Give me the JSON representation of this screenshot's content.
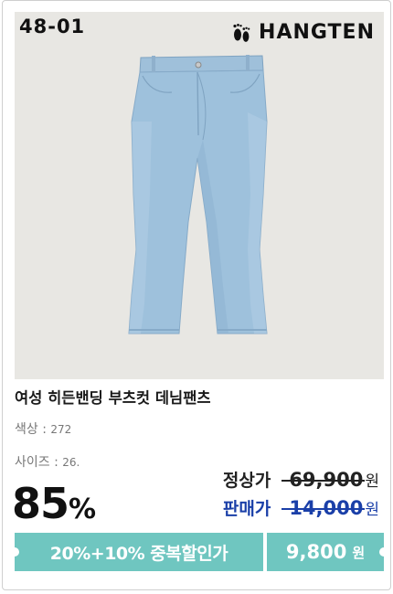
{
  "product": {
    "code": "48-01",
    "brand": "HANGTEN",
    "title": "여성 히든밴딩 부츠컷 데님팬츠",
    "color_label": "색상 : ",
    "color_value": "272",
    "size_label": "사이즈 : ",
    "size_value": "26."
  },
  "pricing": {
    "discount_number": "85",
    "discount_symbol": "%",
    "regular_label": "정상가",
    "regular_price": "69,900",
    "sale_label": "판매가",
    "sale_price": "14,000",
    "won": "원"
  },
  "banner": {
    "promo_text": "20%+10% 중복할인가",
    "final_price": "9,800",
    "won": "원"
  },
  "icons": {
    "brand_logo": "footprints-icon",
    "product_image": "jeans-image"
  },
  "colors": {
    "accent_teal": "#6fc6c0",
    "sale_blue": "#1a3fa8",
    "photo_bg": "#e8e7e3",
    "denim": "#9ec1dc"
  }
}
